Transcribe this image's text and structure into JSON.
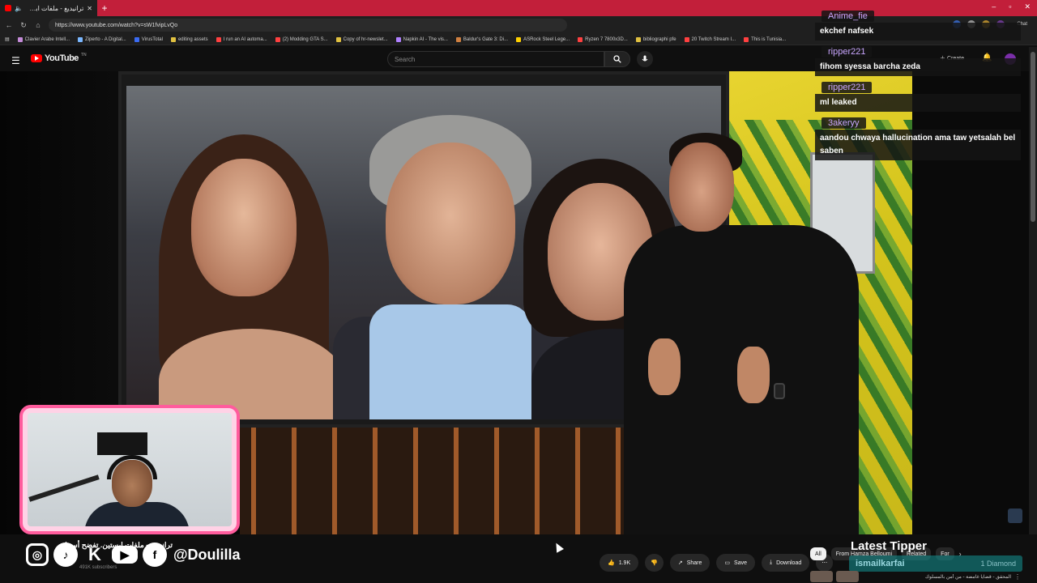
{
  "browser": {
    "tab_title": "ترانيديغ - ملفات ابستين. تفضح",
    "url": "https://www.youtube.com/watch?v=sW1fvipLvQo",
    "chat_label": "Chat",
    "bookmarks": [
      {
        "label": "Clavier Arabe Intell...",
        "color": "#c58bd9"
      },
      {
        "label": "Ziperto - A Digital...",
        "color": "#7ab7ff"
      },
      {
        "label": "VirusTotal",
        "color": "#3b6bf2"
      },
      {
        "label": "editing assets",
        "color": "#e0c040"
      },
      {
        "label": "I run an AI automa...",
        "color": "#ff4040"
      },
      {
        "label": "(2) Modding GTA S...",
        "color": "#ff4040"
      },
      {
        "label": "Copy of hr-newslet...",
        "color": "#e0c040"
      },
      {
        "label": "Napkin AI - The vis...",
        "color": "#b080ff"
      },
      {
        "label": "Baldur's Gate 3: Di...",
        "color": "#d08040"
      },
      {
        "label": "ASRock Steel Lege...",
        "color": "#ffd000"
      },
      {
        "label": "Ryzen 7 7800x3D...",
        "color": "#ff4040"
      },
      {
        "label": "bibliographi pfe",
        "color": "#e0c040"
      },
      {
        "label": "20 Twitch Stream I...",
        "color": "#ff4040"
      },
      {
        "label": "This is Tunisia...",
        "color": "#ff4040"
      }
    ]
  },
  "youtube": {
    "logo_text": "YouTube",
    "logo_tm": "TN",
    "search_placeholder": "Search",
    "create_label": "Create"
  },
  "chat": {
    "messages": [
      {
        "user": "Anime_fie",
        "text": "ekchef nafsek"
      },
      {
        "user": "ripper221",
        "text": "fihom syessa barcha zeda"
      },
      {
        "user": "ripper221",
        "text": "ml leaked"
      },
      {
        "user": "3akeryy",
        "text": "aandou chwaya hallucination ama taw yetsalah bel saben"
      }
    ]
  },
  "overlay": {
    "handle": "@Doulilla",
    "video_title": "ترانيديغ - ملفات ابستين. تفضح أسماء",
    "channel_subs": "491K subscribers"
  },
  "actions": {
    "likes": "1.9K",
    "share": "Share",
    "save": "Save",
    "download": "Download"
  },
  "chips": {
    "all": "All",
    "from_channel": "From Hamza Belloumi",
    "related": "Related",
    "for_you": "For"
  },
  "tipper": {
    "title": "Latest Tipper",
    "name": "ismailkarfai",
    "amount": "1 Diamond"
  },
  "recommended": {
    "title": "المحقق - قضايا غامضة - من أمن بالمسلوك"
  }
}
